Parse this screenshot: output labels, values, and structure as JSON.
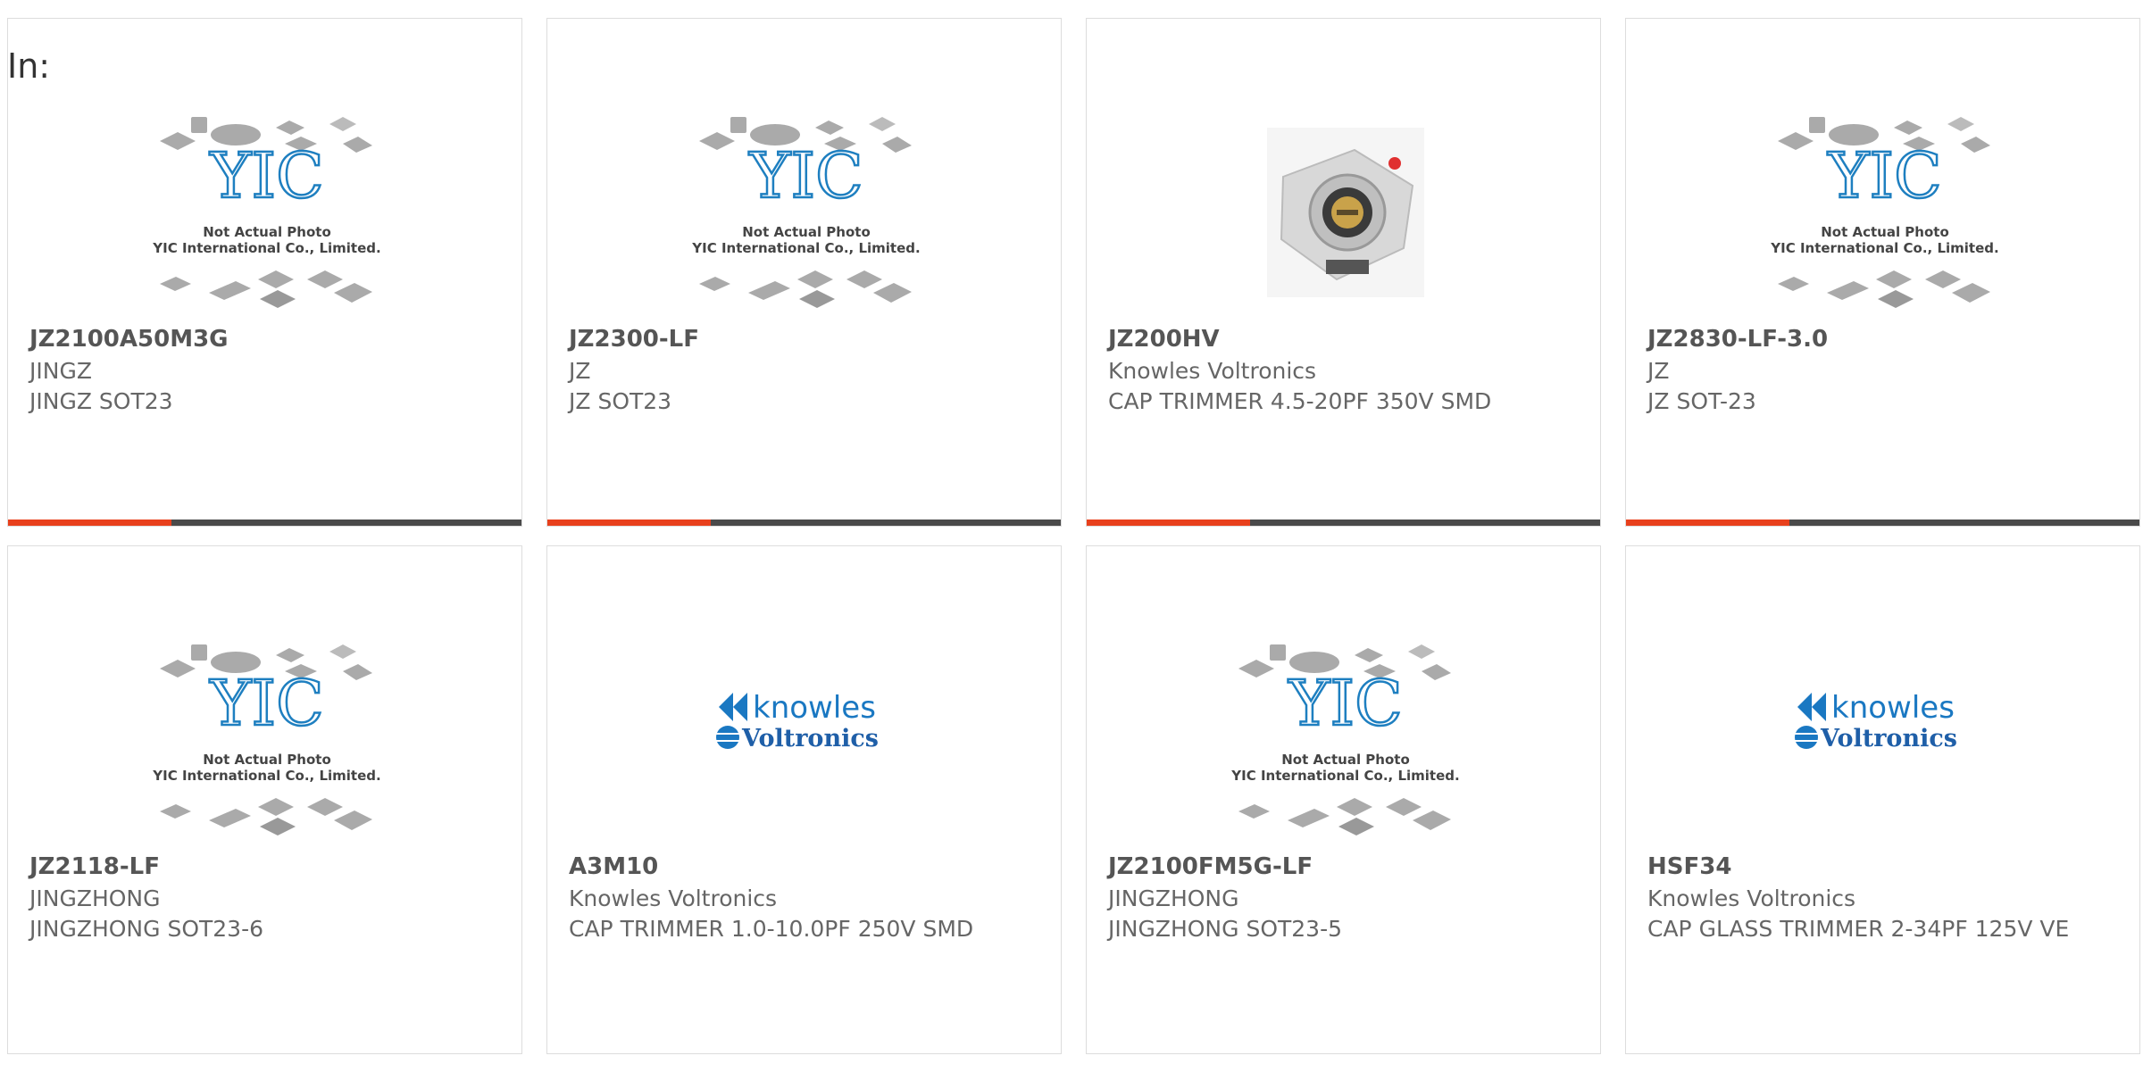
{
  "header": {
    "label": "In:"
  },
  "products": [
    {
      "part": "JZ2100A50M3G",
      "manufacturer": "JINGZ",
      "description": "JINGZ SOT23",
      "image": "yic-placeholder"
    },
    {
      "part": "JZ2300-LF",
      "manufacturer": "JZ",
      "description": "JZ SOT23",
      "image": "yic-placeholder"
    },
    {
      "part": "JZ200HV",
      "manufacturer": "Knowles Voltronics",
      "description": "CAP TRIMMER 4.5-20PF 350V SMD",
      "image": "trimmer-photo"
    },
    {
      "part": "JZ2830-LF-3.0",
      "manufacturer": "JZ",
      "description": "JZ SOT-23",
      "image": "yic-placeholder"
    },
    {
      "part": "JZ2118-LF",
      "manufacturer": "JINGZHONG",
      "description": "JINGZHONG SOT23-6",
      "image": "yic-placeholder"
    },
    {
      "part": "A3M10",
      "manufacturer": "Knowles Voltronics",
      "description": "CAP TRIMMER 1.0-10.0PF 250V SMD",
      "image": "knowles-logo"
    },
    {
      "part": "JZ2100FM5G-LF",
      "manufacturer": "JINGZHONG",
      "description": "JINGZHONG SOT23-5",
      "image": "yic-placeholder"
    },
    {
      "part": "HSF34",
      "manufacturer": "Knowles Voltronics",
      "description": "CAP GLASS TRIMMER 2-34PF 125V VE",
      "image": "knowles-logo"
    }
  ],
  "placeholder": {
    "line1": "Not Actual Photo",
    "line2": "YIC International Co., Limited.",
    "logo": "YIC"
  },
  "knowles": {
    "line1": "knowles",
    "line2": "Voltronics"
  },
  "colors": {
    "accent": "#e8401c",
    "bar": "#4a4a4a",
    "yic_blue": "#1e7fc0",
    "knowles_blue": "#1a78c2"
  }
}
